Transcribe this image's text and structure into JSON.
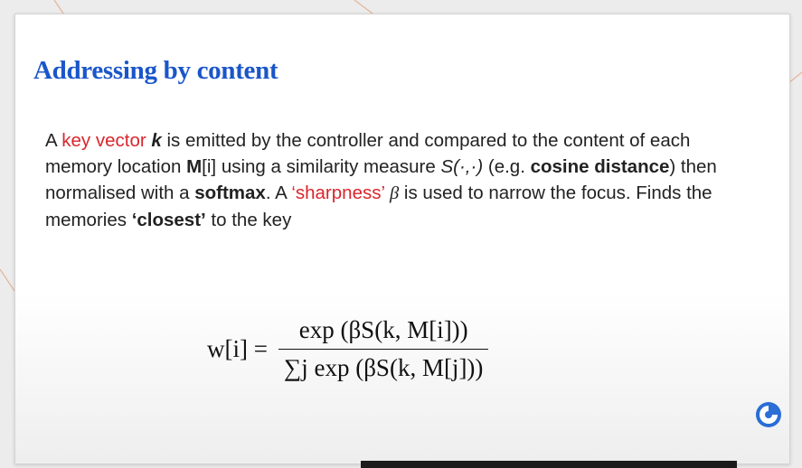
{
  "slide": {
    "title": "Addressing by content",
    "paragraph": {
      "t1": "A ",
      "key_vector": "key vector",
      "k": "k",
      "t2": " is emitted by the controller and compared to the content of each memory location ",
      "m": "M",
      "t3": "[i] using a similarity measure ",
      "s_func": "S(·,·)",
      "t4": " (e.g. ",
      "cosine": "cosine distance",
      "t5": ") then normalised with a ",
      "softmax": "softmax",
      "t6": ". A ",
      "sharpness": "‘sharpness’",
      "beta": "β",
      "t7": " is used to narrow the focus. Finds the memories ",
      "closest": "‘closest’",
      "t8": " to the key"
    },
    "formula": {
      "lhs": "w[i] =",
      "numerator": "exp (βS(k, M[i]))",
      "denominator": "∑j exp (βS(k, M[j]))"
    }
  },
  "colors": {
    "title": "#1a56c9",
    "highlight": "#d9262c",
    "logo": "#2a6ed6"
  },
  "icons": {
    "logo": "deepmind-logo-icon"
  }
}
